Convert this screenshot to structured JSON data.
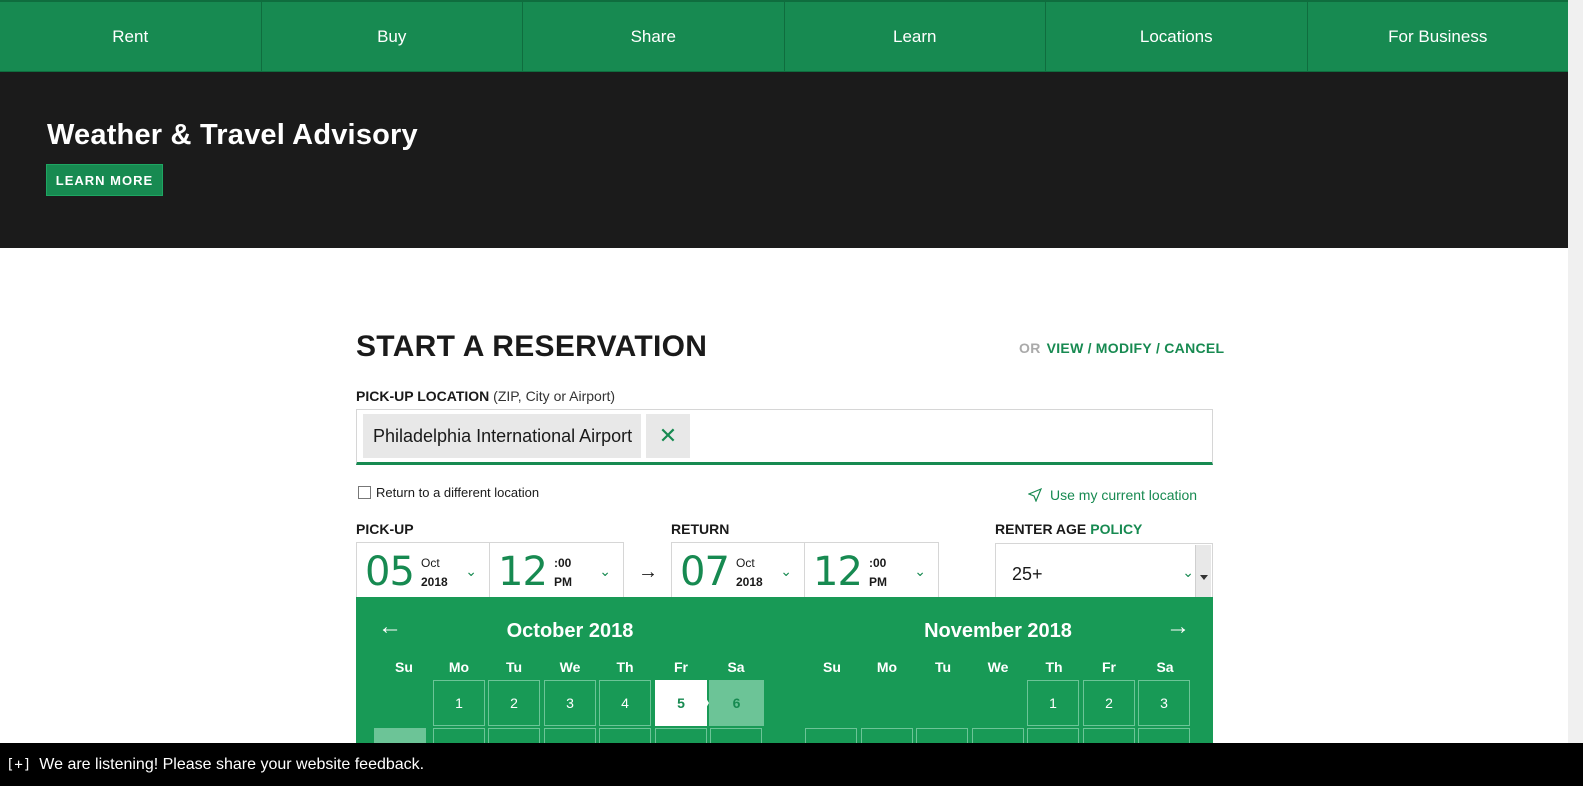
{
  "nav": {
    "items": [
      "Rent",
      "Buy",
      "Share",
      "Learn",
      "Locations",
      "For Business"
    ]
  },
  "advisory": {
    "title": "Weather & Travel Advisory",
    "button": "LEARN MORE"
  },
  "reservation": {
    "title": "START A RESERVATION",
    "or": "OR",
    "links": [
      "VIEW",
      "MODIFY",
      "CANCEL"
    ],
    "location_label": "PICK-UP LOCATION",
    "location_hint": "(ZIP, City or Airport)",
    "location_value": "Philadelphia International Airport",
    "clear_glyph": "✕",
    "return_diff": "Return to a different location",
    "use_location": "Use my current location",
    "pickup_label": "PICK-UP",
    "return_label": "RETURN",
    "age_label": "RENTER AGE",
    "policy": "POLICY",
    "pickup": {
      "day": "05",
      "month": "Oct",
      "year": "2018",
      "hour": "12",
      "minutes": ":00",
      "ampm": "PM"
    },
    "return": {
      "day": "07",
      "month": "Oct",
      "year": "2018",
      "hour": "12",
      "minutes": ":00",
      "ampm": "PM"
    },
    "age_value": "25+"
  },
  "calendar": {
    "prev_glyph": "←",
    "next_glyph": "→",
    "left": {
      "title": "October 2018",
      "dow": [
        "Su",
        "Mo",
        "Tu",
        "We",
        "Th",
        "Fr",
        "Sa"
      ],
      "days": [
        "1",
        "2",
        "3",
        "4",
        "5",
        "6"
      ]
    },
    "right": {
      "title": "November 2018",
      "dow": [
        "Su",
        "Mo",
        "Tu",
        "We",
        "Th",
        "Fr",
        "Sa"
      ],
      "days": [
        "1",
        "2",
        "3"
      ]
    }
  },
  "feedback": {
    "plus": "[+]",
    "text": "We are listening! Please share your website feedback."
  },
  "colors": {
    "brand_green": "#178a51",
    "calendar_green": "#189a56",
    "range_green": "#6cc497",
    "advisory_bg": "#1b1b1b"
  }
}
